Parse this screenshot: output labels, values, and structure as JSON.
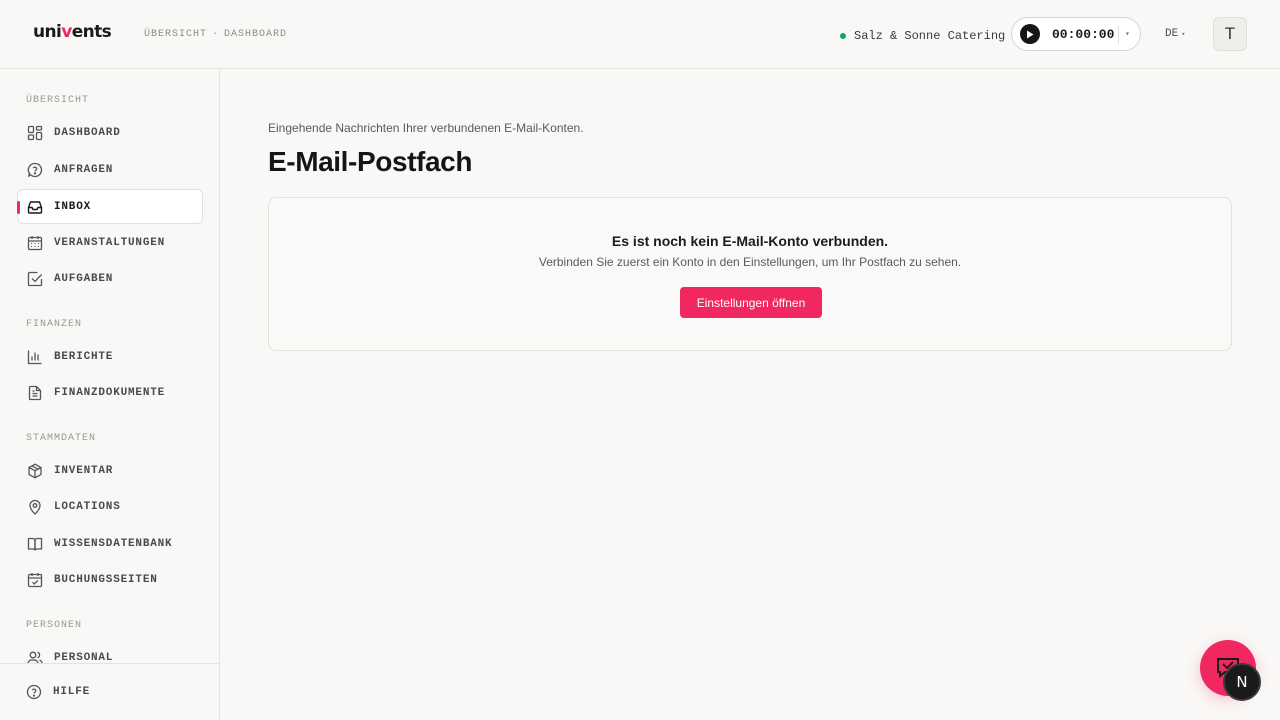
{
  "header": {
    "logo": {
      "part1": "uni",
      "part2": "v",
      "part3": "ents"
    },
    "breadcrumb": {
      "first": "ÜBERSICHT",
      "separator": "·",
      "second": "DASHBOARD"
    },
    "company": "Salz & Sonne Catering",
    "timer": "00:00:00",
    "language": "DE",
    "avatar_letter": "T"
  },
  "sidebar": {
    "sections": [
      {
        "title": "ÜBERSICHT",
        "items": [
          {
            "label": "DASHBOARD",
            "icon": "dashboard-icon"
          },
          {
            "label": "ANFRAGEN",
            "icon": "question-circle-icon"
          },
          {
            "label": "INBOX",
            "icon": "inbox-icon",
            "active": true
          },
          {
            "label": "VERANSTALTUNGEN",
            "icon": "calendar-icon"
          },
          {
            "label": "AUFGABEN",
            "icon": "checkbox-icon"
          }
        ]
      },
      {
        "title": "FINANZEN",
        "items": [
          {
            "label": "BERICHTE",
            "icon": "bar-chart-icon"
          },
          {
            "label": "FINANZDOKUMENTE",
            "icon": "document-icon"
          }
        ]
      },
      {
        "title": "STAMMDATEN",
        "items": [
          {
            "label": "INVENTAR",
            "icon": "box-icon"
          },
          {
            "label": "LOCATIONS",
            "icon": "map-pin-icon"
          },
          {
            "label": "WISSENSDATENBANK",
            "icon": "book-icon"
          },
          {
            "label": "BUCHUNGSSEITEN",
            "icon": "calendar-check-icon"
          }
        ]
      },
      {
        "title": "PERSONEN",
        "items": [
          {
            "label": "PERSONAL",
            "icon": "users-icon"
          }
        ]
      }
    ],
    "footer": {
      "label": "HILFE",
      "icon": "help-circle-icon"
    }
  },
  "main": {
    "subtitle": "Eingehende Nachrichten Ihrer verbundenen E-Mail-Konten.",
    "title": "E-Mail-Postfach",
    "empty_state": {
      "title": "Es ist noch kein E-Mail-Konto verbunden.",
      "text": "Verbinden Sie zuerst ein Konto in den Einstellungen, um Ihr Postfach zu sehen.",
      "button": "Einstellungen öffnen"
    }
  },
  "floating": {
    "chat_icon": "chat-icon",
    "dev_badge": "N"
  },
  "colors": {
    "accent": "#f0285f",
    "status_online": "#19a35a",
    "background": "#f9f8f6"
  }
}
